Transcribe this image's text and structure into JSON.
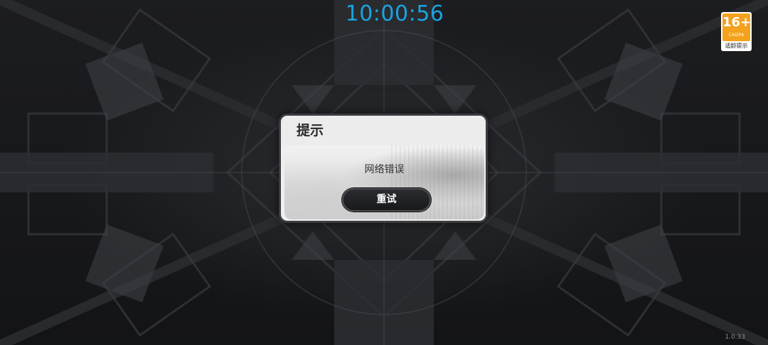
{
  "clock": {
    "time": "10:00:56",
    "color": "#1aa3e0"
  },
  "age_rating": {
    "value": "16+",
    "org": "CADPA",
    "caption": "适龄提示",
    "color": "#f4a11e",
    "icon": "age-rating-badge-icon"
  },
  "dialog": {
    "title": "提示",
    "message": "网络错误",
    "retry_label": "重试"
  },
  "footer": {
    "version": "1.0.33"
  },
  "background": {
    "style": "dark mechanical kaleidoscope artwork",
    "accent": "#151618"
  }
}
